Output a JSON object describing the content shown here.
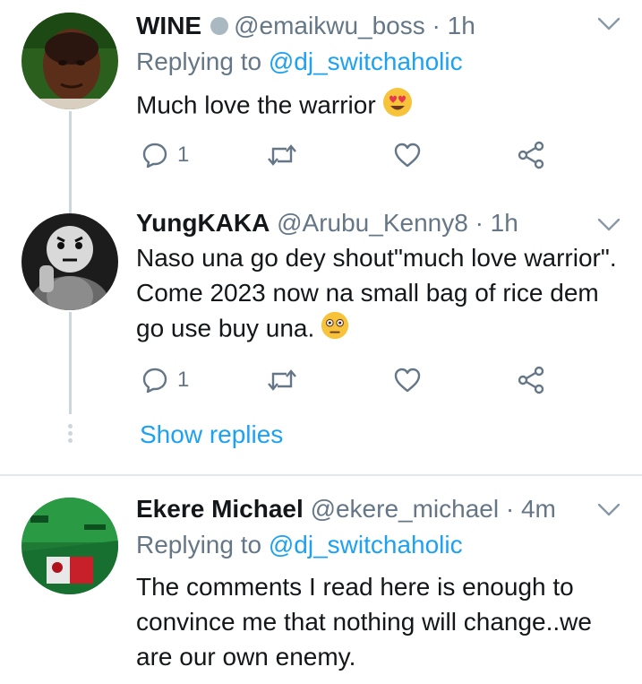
{
  "tweets": [
    {
      "name": "WINE",
      "handle": "@emaikwu_boss",
      "time": "· 1h",
      "replying_prefix": "Replying to ",
      "replying_to": "@dj_switchaholic",
      "text": "Much love the warrior",
      "emoji": "heart-eyes-emoji",
      "reply_count": "1",
      "retweet_count": "",
      "like_count": ""
    },
    {
      "name": "YungKAKA",
      "handle": "@Arubu_Kenny8",
      "time": "· 1h",
      "text": "Naso una go dey shout\"much love warrior\". Come 2023 now na small bag of rice dem go use buy una.",
      "emoji": "flushed-emoji",
      "reply_count": "1",
      "retweet_count": "",
      "like_count": ""
    },
    {
      "name": "Ekere Michael",
      "handle": "@ekere_michael",
      "time": "· 4m",
      "replying_prefix": "Replying to ",
      "replying_to": "@dj_switchaholic",
      "text": "The comments I read here is enough to convince me that nothing will change..we are our own enemy."
    }
  ],
  "show_replies": "Show replies",
  "colors": {
    "link": "#1da1f2",
    "muted": "#657786",
    "thread_line": "#ccd6dd",
    "divider": "#e1e8ed"
  }
}
